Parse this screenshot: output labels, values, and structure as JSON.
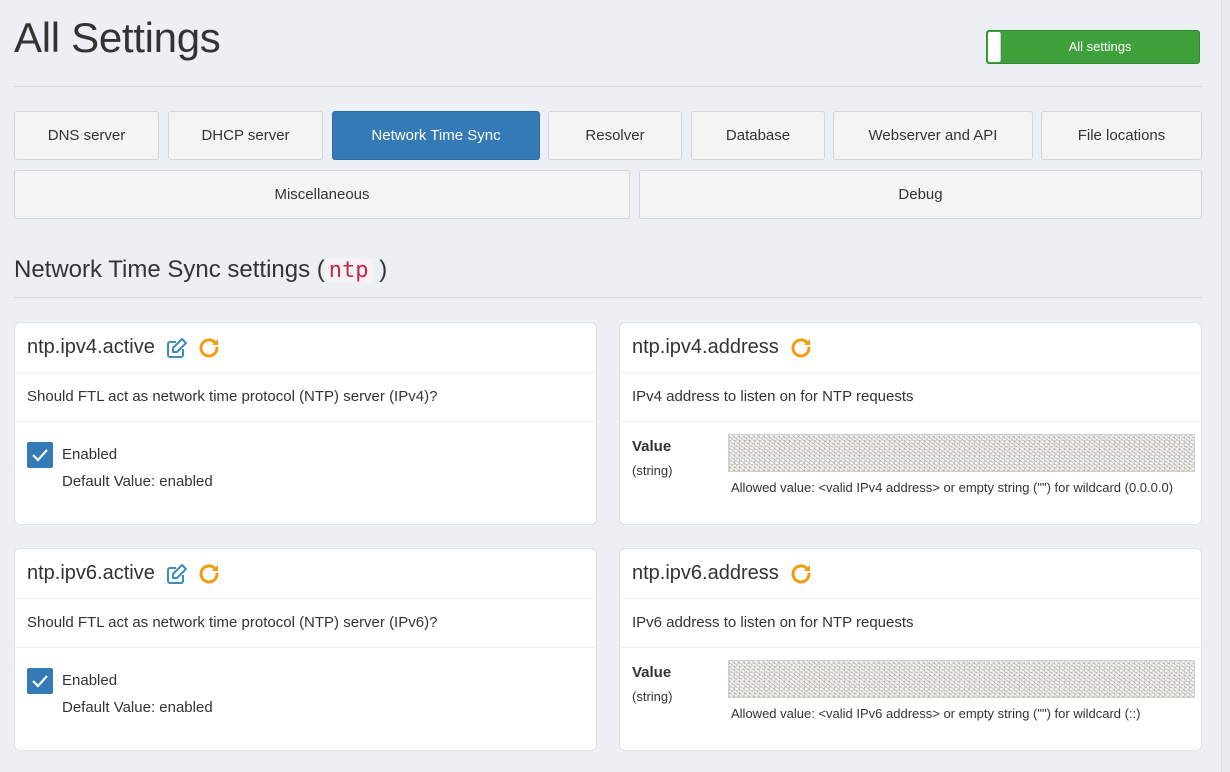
{
  "page": {
    "title": "All Settings"
  },
  "toggle": {
    "label": "All settings",
    "state": "on",
    "color": "#3ea03a"
  },
  "tabs": [
    {
      "label": "DNS server",
      "active": false
    },
    {
      "label": "DHCP server",
      "active": false
    },
    {
      "label": "Network Time Sync",
      "active": true
    },
    {
      "label": "Resolver",
      "active": false
    },
    {
      "label": "Database",
      "active": false
    },
    {
      "label": "Webserver and API",
      "active": false
    },
    {
      "label": "File locations",
      "active": false
    },
    {
      "label": "Miscellaneous",
      "active": false
    },
    {
      "label": "Debug",
      "active": false
    }
  ],
  "section": {
    "title_prefix": "Network Time Sync settings (",
    "code": "ntp",
    "title_suffix": ")"
  },
  "cards": [
    {
      "key": "ntp.ipv4.active",
      "description": "Should FTL act as network time protocol (NTP) server (IPv4)?",
      "enabled_label": "Enabled",
      "checked": true,
      "default": "Default Value: enabled",
      "icons": [
        "edit-icon",
        "reset-icon"
      ]
    },
    {
      "key": "ntp.ipv4.address",
      "description": "IPv4 address to listen on for NTP requests",
      "value_label": "Value",
      "value_type": "(string)",
      "value": "",
      "help": "Allowed value: <valid IPv4 address> or empty string (\"\") for wildcard (0.0.0.0)",
      "icons": [
        "reset-icon"
      ]
    },
    {
      "key": "ntp.ipv6.active",
      "description": "Should FTL act as network time protocol (NTP) server (IPv6)?",
      "enabled_label": "Enabled",
      "checked": true,
      "default": "Default Value: enabled",
      "icons": [
        "edit-icon",
        "reset-icon"
      ]
    },
    {
      "key": "ntp.ipv6.address",
      "description": "IPv6 address to listen on for NTP requests",
      "value_label": "Value",
      "value_type": "(string)",
      "value": "",
      "help": "Allowed value: <valid IPv6 address> or empty string (\"\") for wildcard (::)",
      "icons": [
        "reset-icon"
      ]
    }
  ],
  "colors": {
    "active_tab": "#337ab7",
    "edit_icon": "#3c8dbc",
    "reset_icon": "#f39c12",
    "code_text": "#c7254e"
  }
}
